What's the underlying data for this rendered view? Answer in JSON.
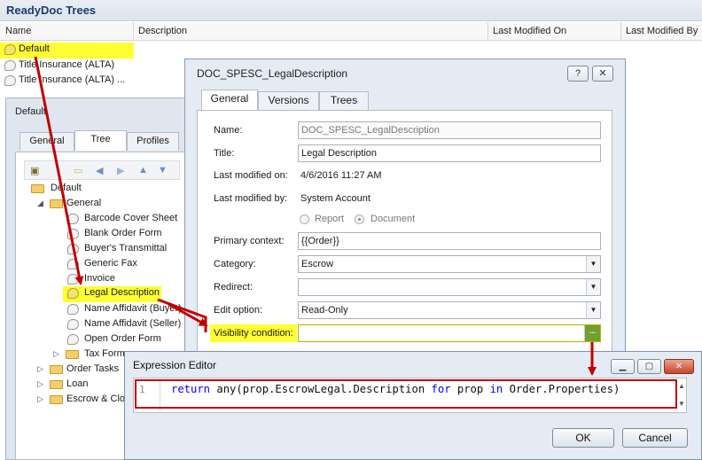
{
  "app_title": "ReadyDoc Trees",
  "columns": [
    "Name",
    "Description",
    "Last Modified On",
    "Last Modified By"
  ],
  "tree_list": [
    {
      "name": "Default",
      "highlighted": true
    },
    {
      "name": "Title Insurance (ALTA)",
      "highlighted": false
    },
    {
      "name": "Title Insurance (ALTA) ...",
      "highlighted": false
    }
  ],
  "left_dialog": {
    "title": "Default",
    "tabs": [
      "General",
      "Tree",
      "Profiles"
    ],
    "active_tab": "Tree",
    "tree": {
      "root": "Default",
      "general_folder": "General",
      "general_items": [
        "Barcode Cover Sheet",
        "Blank Order Form",
        "Buyer's Transmittal",
        "Generic Fax",
        "Invoice",
        "Legal Description",
        "Name Affidavit (Buyer)",
        "Name Affidavit (Seller)",
        "Open Order Form"
      ],
      "subfolder": "Tax Forms",
      "top_folders": [
        "Order Tasks",
        "Loan",
        "Escrow & Closing"
      ]
    }
  },
  "main_dialog": {
    "title": "DOC_SPESC_LegalDescription",
    "help_label": "?",
    "close_label": "✕",
    "tabs": [
      "General",
      "Versions",
      "Trees"
    ],
    "fields": {
      "name_label": "Name:",
      "name_value": "DOC_SPESC_LegalDescription",
      "title_label": "Title:",
      "title_value": "Legal Description",
      "last_modified_on_label": "Last modified on:",
      "last_modified_on_value": "4/6/2016 11:27 AM",
      "last_modified_by_label": "Last modified by:",
      "last_modified_by_value": "System Account",
      "radio_report": "Report",
      "radio_document": "Document",
      "primary_context_label": "Primary context:",
      "primary_context_value": "{{Order}}",
      "category_label": "Category:",
      "category_value": "Escrow",
      "redirect_label": "Redirect:",
      "redirect_value": "",
      "edit_option_label": "Edit option:",
      "edit_option_value": "Read-Only",
      "visibility_label": "Visibility condition:",
      "visibility_value": "",
      "visibility_button": "..."
    }
  },
  "expression_editor": {
    "title": "Expression Editor",
    "line_number": "1",
    "code": {
      "kw_return": "return",
      "fn_any": " any(prop.EscrowLegal.Description ",
      "kw_for": "for",
      "var_prop": " prop ",
      "kw_in": "in",
      "tail": " Order.Properties)"
    },
    "ok_label": "OK",
    "cancel_label": "Cancel",
    "min_label": "▁",
    "max_label": "▢",
    "close_label": "✕"
  },
  "colors": {
    "highlight": "#ffff33",
    "annotation_red": "#c00000",
    "keyword_blue": "#0000ff"
  }
}
